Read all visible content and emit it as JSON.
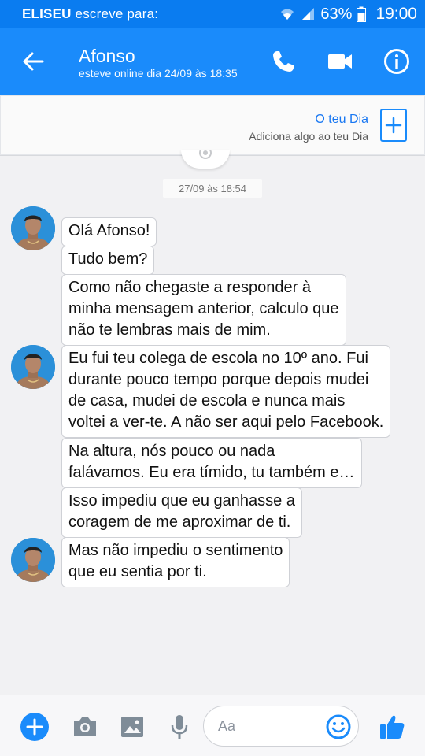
{
  "status_bar": {
    "notification_sender": "ELISEU",
    "notification_text": "escreve para:",
    "battery": "63%",
    "time": "19:00"
  },
  "header": {
    "contact_name": "Afonso",
    "last_seen": "esteve online dia 24/09 às 18:35",
    "icons": [
      "back-arrow-icon",
      "phone-icon",
      "video-camera-icon",
      "info-icon"
    ]
  },
  "story": {
    "title": "O teu Dia",
    "subtitle": "Adiciona algo ao teu Dia"
  },
  "conversation": {
    "timestamp": "27/09 às 18:54",
    "messages": [
      {
        "text": "Olá Afonso!"
      },
      {
        "text": "Tudo bem?"
      },
      {
        "text": "Como não chegaste a responder à\nminha mensagem anterior, calculo que\nnão te lembras mais de mim."
      },
      {
        "text": "Eu fui teu colega de escola no 10º ano. Fui\ndurante pouco tempo porque depois mudei\nde casa, mudei de escola e nunca mais\nvoltei a ver-te. A não ser aqui pelo Facebook."
      },
      {
        "text": "Na altura, nós pouco ou nada\nfalávamos. Eu era tímido, tu também e…"
      },
      {
        "text": "Isso impediu que eu ganhasse a\ncoragem de me aproximar de ti."
      },
      {
        "text": "Mas não impediu o sentimento\nque eu sentia por ti."
      }
    ]
  },
  "composer": {
    "placeholder": "Aa",
    "icons": [
      "plus-icon",
      "camera-icon",
      "image-icon",
      "microphone-icon",
      "emoji-icon",
      "thumbs-up-icon"
    ]
  },
  "colors": {
    "header_blue": "#1a8bfb",
    "accent_blue": "#1877f2"
  }
}
